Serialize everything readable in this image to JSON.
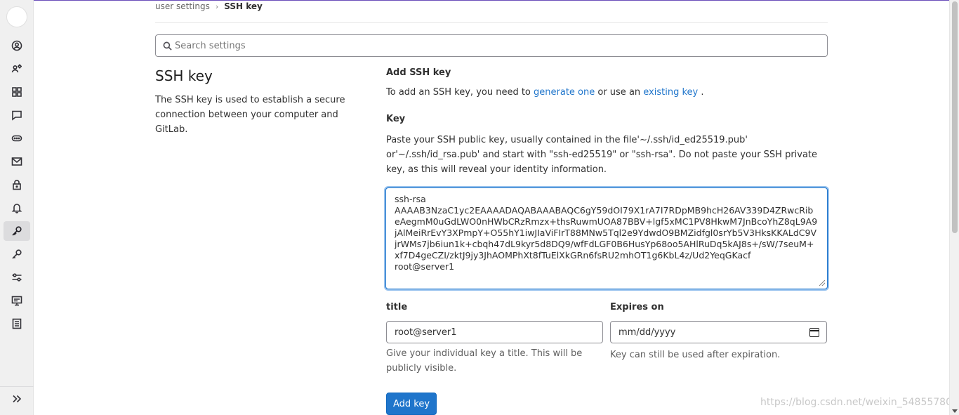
{
  "breadcrumb": {
    "parent": "user settings",
    "separator": "›",
    "current": "SSH key"
  },
  "search": {
    "placeholder": "Search settings"
  },
  "page": {
    "title": "SSH key",
    "description": "The SSH key is used to establish a secure connection between your computer and GitLab."
  },
  "add_key": {
    "title": "Add SSH key",
    "intro_prefix": "To add an SSH key, you need to ",
    "generate_link": "generate one",
    "intro_mid": " or use an ",
    "existing_link": "existing key",
    "intro_suffix": " ."
  },
  "key": {
    "label": "Key",
    "help": "Paste your SSH public key, usually contained in the file'~/.ssh/id_ed25519.pub' or'~/.ssh/id_rsa.pub' and start with \"ssh-ed25519\" or \"ssh-rsa\". Do not paste your SSH private key, as this will reveal your identity information.",
    "value": "ssh-rsa\nAAAAB3NzaC1yc2EAAAADAQABAAABAQC6gY59dOI79X1rA7I7RDpMB9hcH26AV339D4ZRwcRibeAegmM0uGdLWO0nHWbCRzRmzx+thsRuwmUOA87BBV+lgf5xMC1PV8HkwM7JnBcoYhZ8qL9A9jAlMeiRrEvY3XPmpY+O55hY1iwJIaViFIrT88MNw5Tql2e9YdwdO9BMZidfgl0srYb5V3HksKKALdC9VjrWMs7jb6iun1k+cbqh47dL9kyr5d8DQ9/wfFdLGF0B6HusYp68oo5AHlRuDq5kAJ8s+/sW/7seuM+xf7D4geCZI/zktJ9jy3JhAOMPhXt8fTuElXkGRn6fsRU2mhOT1g6KbL4z/Ud2YeqGKacf\nroot@server1"
  },
  "title_field": {
    "label": "title",
    "value": "root@server1",
    "help": "Give your individual key a title. This will be publicly visible."
  },
  "expires": {
    "label": "Expires on",
    "placeholder": "mm/dd/yyyy",
    "help": "Key can still be used after expiration."
  },
  "submit": {
    "label": "Add key"
  },
  "watermark": "https://blog.csdn.net/weixin_54855780",
  "sidebar": {
    "items": [
      {
        "name": "profile-icon"
      },
      {
        "name": "account-icon"
      },
      {
        "name": "applications-icon"
      },
      {
        "name": "chat-icon"
      },
      {
        "name": "token-icon"
      },
      {
        "name": "emails-icon"
      },
      {
        "name": "password-lock-icon"
      },
      {
        "name": "notifications-bell-icon"
      },
      {
        "name": "ssh-keys-icon",
        "active": true
      },
      {
        "name": "gpg-keys-icon"
      },
      {
        "name": "preferences-icon"
      },
      {
        "name": "active-sessions-icon"
      },
      {
        "name": "authentication-log-icon"
      }
    ],
    "collapse": "collapse-sidebar-icon"
  },
  "colors": {
    "accent": "#1f75cb",
    "top_line": "#6b4fbb"
  }
}
